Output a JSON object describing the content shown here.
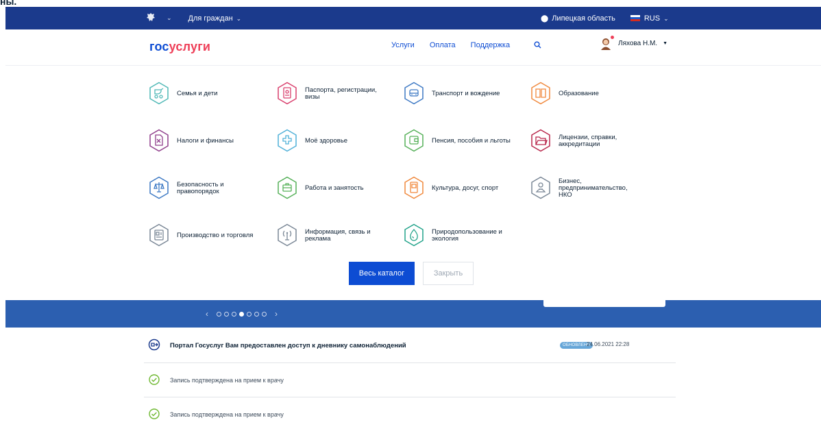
{
  "doc_label": "ны.",
  "topbar": {
    "audience": "Для граждан",
    "region": "Липецкая область",
    "language": "RUS"
  },
  "header": {
    "logo_part1": "гос",
    "logo_part2": "услуги",
    "nav": [
      "Услуги",
      "Оплата",
      "Поддержка"
    ],
    "user_name": "Ляхова Н.М."
  },
  "categories": [
    {
      "label": "Семья и дети",
      "color": "#4fb8b6",
      "icon": "stroller-icon"
    },
    {
      "label": "Паспорта, регистрации, визы",
      "color": "#d93e6c",
      "icon": "passport-icon"
    },
    {
      "label": "Транспорт и вождение",
      "color": "#3d79c4",
      "icon": "car-icon"
    },
    {
      "label": "Образование",
      "color": "#f0883c",
      "icon": "book-icon"
    },
    {
      "label": "Налоги и финансы",
      "color": "#8f3d8b",
      "icon": "tax-document-icon"
    },
    {
      "label": "Моё здоровье",
      "color": "#4fb0d8",
      "icon": "medical-cross-icon"
    },
    {
      "label": "Пенсия, пособия и льготы",
      "color": "#55b058",
      "icon": "wallet-icon"
    },
    {
      "label": "Лицензии, справки, аккредитации",
      "color": "#b8254a",
      "icon": "folder-icon"
    },
    {
      "label": "Безопасность и правопорядок",
      "color": "#3d79c4",
      "icon": "scales-icon"
    },
    {
      "label": "Работа и занятость",
      "color": "#55b058",
      "icon": "briefcase-icon"
    },
    {
      "label": "Культура, досуг, спорт",
      "color": "#f0883c",
      "icon": "theater-icon"
    },
    {
      "label": "Бизнес, предпринимательство, НКО",
      "color": "#7a8796",
      "icon": "business-person-icon"
    },
    {
      "label": "Производство и торговля",
      "color": "#7a8796",
      "icon": "factory-card-icon"
    },
    {
      "label": "Информация, связь и реклама",
      "color": "#7a8796",
      "icon": "antenna-icon"
    },
    {
      "label": "Природопользование и экология",
      "color": "#22a38a",
      "icon": "water-drop-icon"
    }
  ],
  "actions": {
    "catalog": "Весь каталог",
    "close": "Закрыть"
  },
  "slider": {
    "total": 7,
    "active": 4
  },
  "feed": [
    {
      "text": "Портал Госуслуг Вам предоставлен доступ к дневнику самонаблюдений",
      "badge": "ОБНОВЛЕНО",
      "date": "24.06.2021 22:28",
      "icon": "portal-login-icon"
    },
    {
      "text": "Запись подтверждена на прием к врачу",
      "icon": "check-circle-icon"
    },
    {
      "text": "Запись подтверждена на прием к врачу",
      "icon": "check-circle-icon"
    }
  ],
  "colors": {
    "topbar": "#1b3a8c",
    "accent": "#0d4cd3",
    "logo_red": "#ee3f58",
    "banner": "#2c5fb0",
    "check_green": "#6fb831"
  }
}
